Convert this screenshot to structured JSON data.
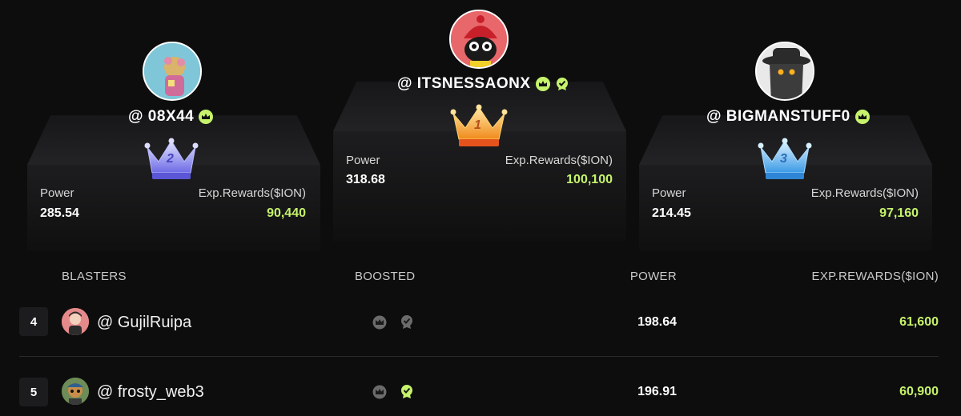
{
  "podium": {
    "first": {
      "rank": "1",
      "handle": "@ ITSNESSAONX",
      "power_label": "Power",
      "power": "318.68",
      "rewards_label": "Exp.Rewards($ION)",
      "rewards": "100,100"
    },
    "second": {
      "rank": "2",
      "handle": "@ 08X44",
      "power_label": "Power",
      "power": "285.54",
      "rewards_label": "Exp.Rewards($ION)",
      "rewards": "90,440"
    },
    "third": {
      "rank": "3",
      "handle": "@ BIGMANSTUFF0",
      "power_label": "Power",
      "power": "214.45",
      "rewards_label": "Exp.Rewards($ION)",
      "rewards": "97,160"
    }
  },
  "table": {
    "headers": {
      "blasters": "BLASTERS",
      "boosted": "BOOSTED",
      "power": "POWER",
      "rewards": "EXP.REWARDS($ION)"
    },
    "rows": [
      {
        "rank": "4",
        "handle": "@ GujilRuipa",
        "power": "198.64",
        "rewards": "61,600"
      },
      {
        "rank": "5",
        "handle": "@ frosty_web3",
        "power": "196.91",
        "rewards": "60,900"
      }
    ]
  },
  "colors": {
    "accent_green": "#c6f36b",
    "gold": "#f4b43a",
    "silver_purple": "#8f8cf0",
    "blue": "#5ab2f2"
  }
}
